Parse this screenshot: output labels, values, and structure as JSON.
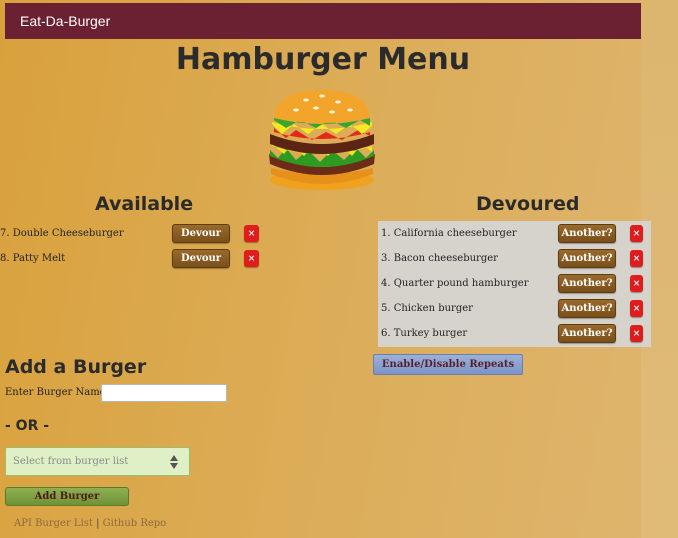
{
  "navbar": {
    "brand": "Eat-Da-Burger"
  },
  "page": {
    "title": "Hamburger Menu"
  },
  "available": {
    "heading": "Available",
    "items": [
      {
        "label": "7. Double Cheeseburger",
        "action": "Devour",
        "remove": "×"
      },
      {
        "label": "8. Patty Melt",
        "action": "Devour",
        "remove": "×"
      }
    ]
  },
  "devoured": {
    "heading": "Devoured",
    "items": [
      {
        "label": "1. California cheeseburger",
        "action": "Another?",
        "remove": "×"
      },
      {
        "label": "3. Bacon cheeseburger",
        "action": "Another?",
        "remove": "×"
      },
      {
        "label": "4. Quarter pound hamburger",
        "action": "Another?",
        "remove": "×"
      },
      {
        "label": "5. Chicken burger",
        "action": "Another?",
        "remove": "×"
      },
      {
        "label": "6. Turkey burger",
        "action": "Another?",
        "remove": "×"
      }
    ],
    "toggle_label": "Enable/Disable Repeats"
  },
  "add_form": {
    "heading": "Add a Burger",
    "name_label": "Enter Burger Name:",
    "name_value": "",
    "or_text": "- OR -",
    "select_placeholder": "Select from burger list",
    "submit_label": "Add Burger"
  },
  "footer": {
    "api_link": "API Burger List",
    "separator": "|",
    "repo_link": "Github Repo"
  },
  "colors": {
    "navbar": "#6b2131",
    "devour_button": "#8a5c22",
    "remove_button": "#e01d1d",
    "add_button": "#7fa043",
    "repeat_button": "#8ba3d0"
  },
  "icons": {
    "remove": "close-icon",
    "select": "sort-arrows-icon",
    "logo": "hamburger-icon"
  }
}
